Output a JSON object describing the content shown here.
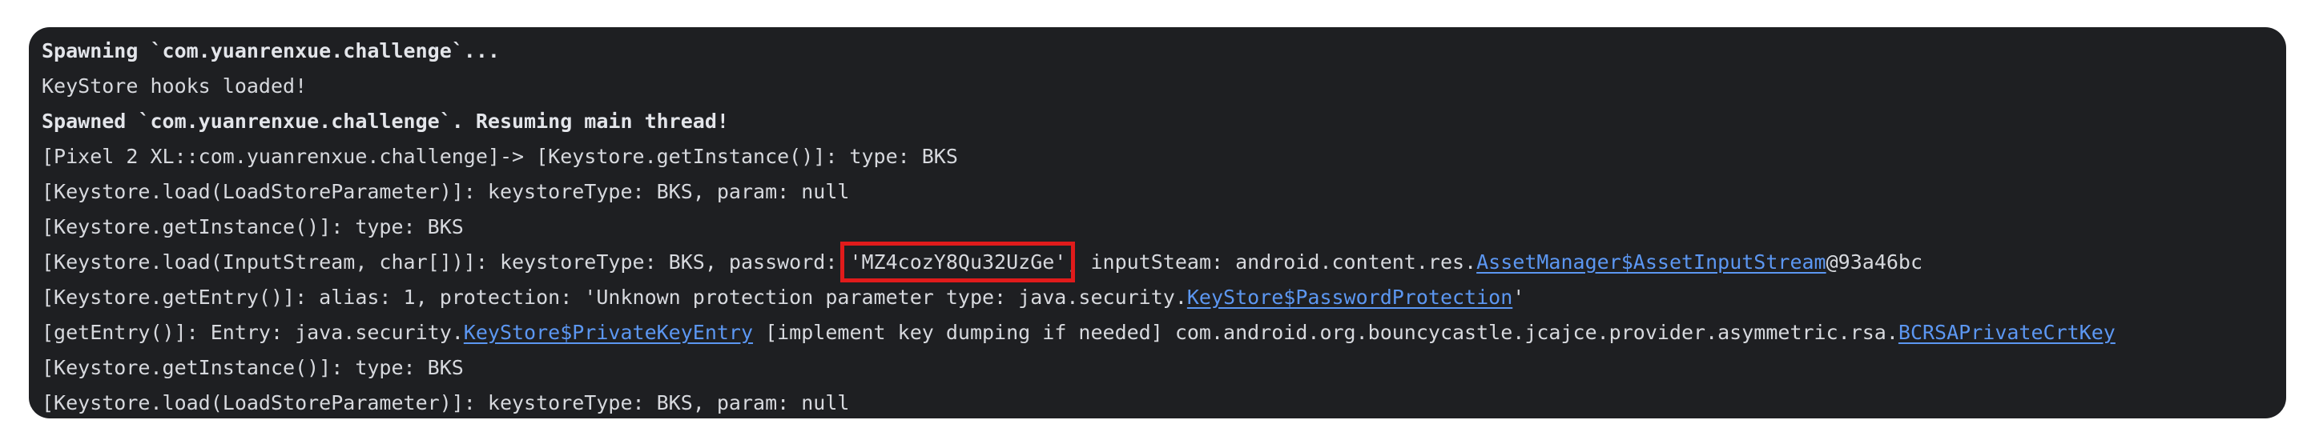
{
  "terminal": {
    "lines": [
      {
        "bold": true,
        "text": "Spawning `com.yuanrenxue.challenge`..."
      },
      {
        "text": "KeyStore hooks loaded!"
      },
      {
        "bold": true,
        "text": "Spawned `com.yuanrenxue.challenge`. Resuming main thread!"
      },
      {
        "text": "[Pixel 2 XL::com.yuanrenxue.challenge]-> [Keystore.getInstance()]: type: BKS"
      },
      {
        "text": "[Keystore.load(LoadStoreParameter)]: keystoreType: BKS, param: null"
      },
      {
        "text": "[Keystore.getInstance()]: type: BKS"
      },
      {
        "pre": "[Keystore.load(InputStream, char[])]: keystoreType: BKS, password: ",
        "password": "'MZ4cozY8Qu32UzGe'",
        "mid": ", inputSteam: android.content.res.",
        "link": "AssetManager$AssetInputStream",
        "post": "@93a46bc"
      },
      {
        "pre": "[Keystore.getEntry()]: alias: 1, protection: 'Unknown protection parameter type: java.security.",
        "link": "KeyStore$PasswordProtection",
        "post": "'"
      },
      {
        "pre": "[getEntry()]: Entry: java.security.",
        "link": "KeyStore$PrivateKeyEntry",
        "mid": " [implement key dumping if needed] com.android.org.bouncycastle.jcajce.provider.asymmetric.rsa.",
        "link2": "BCRSAPrivateCrtKey"
      },
      {
        "text": "[Keystore.getInstance()]: type: BKS"
      },
      {
        "text": "[Keystore.load(LoadStoreParameter)]: keystoreType: BKS, param: null"
      }
    ]
  },
  "colors": {
    "terminal_bg": "#1e1f22",
    "text": "#d7d9de",
    "link": "#5c97f2",
    "highlight_box": "#e01b1b"
  }
}
